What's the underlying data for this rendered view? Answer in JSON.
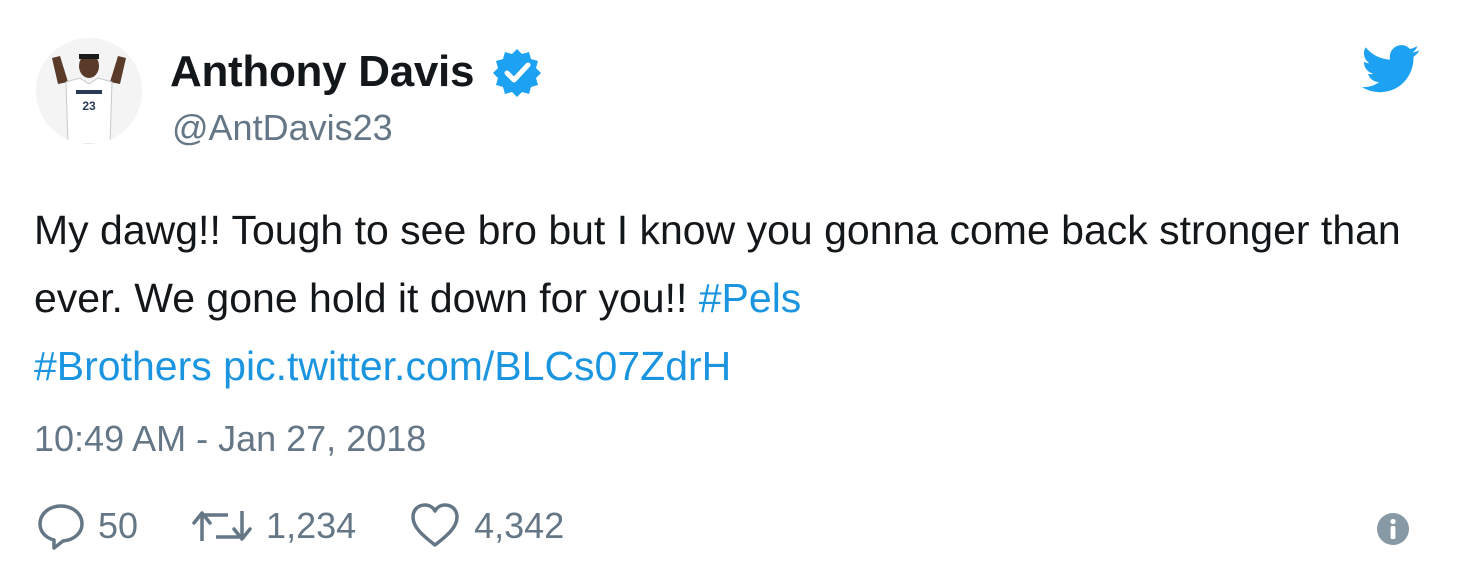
{
  "author": {
    "display_name": "Anthony Davis",
    "handle": "@AntDavis23",
    "avatar_jersey_number": "23",
    "verified": true
  },
  "tweet": {
    "text_plain": "My dawg!! Tough to see bro but I know you gonna come back stronger than ever. We gone hold it down for you!! ",
    "hashtag_1": "#Pels",
    "hashtag_2": "#Brothers",
    "media_link": "pic.twitter.com/BLCs07ZdrH",
    "timestamp": "10:49 AM - Jan 27, 2018"
  },
  "stats": {
    "replies": "50",
    "retweets": "1,234",
    "likes": "4,342"
  },
  "colors": {
    "link": "#1b95e0",
    "secondary_text": "#657786",
    "primary_text": "#14171a",
    "verified_badge": "#1da1f2"
  },
  "icons": {
    "brand": "twitter-bird-icon",
    "reply": "reply-bubble-icon",
    "retweet": "retweet-arrows-icon",
    "like": "heart-icon",
    "info": "info-circle-icon",
    "verified": "verified-badge-icon"
  }
}
